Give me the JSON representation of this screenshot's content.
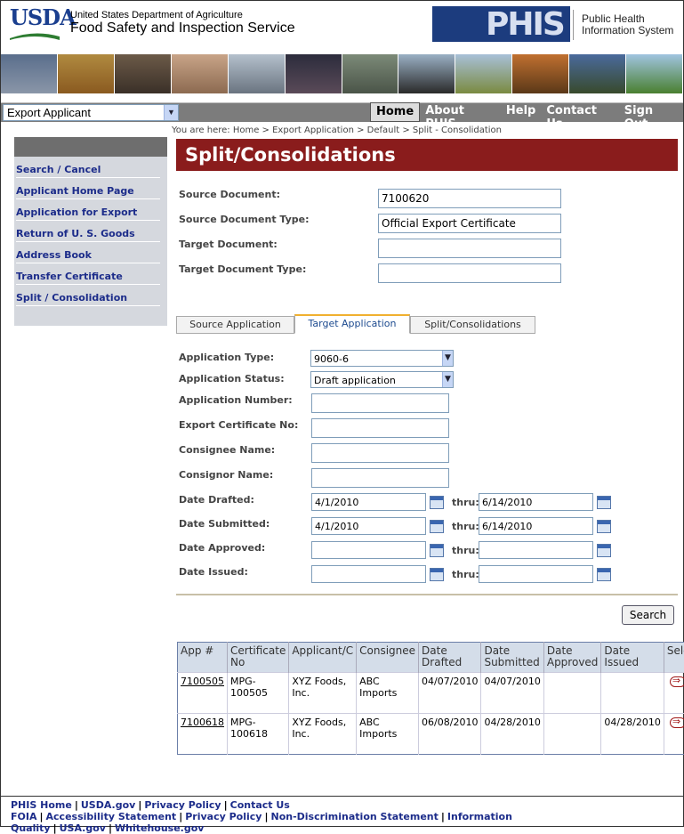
{
  "header": {
    "usda_logo": "USDA",
    "dept_name": "United States Department of Agriculture",
    "agency_name": "Food Safety and Inspection Service",
    "phis_logo": "PHIS",
    "phis_name_line1": "Public Health",
    "phis_name_line2": "Information System"
  },
  "role_select": {
    "value": "Export Applicant"
  },
  "nav": [
    "Home",
    "About PHIS",
    "Help",
    "Contact Us",
    "Sign Out"
  ],
  "breadcrumb": "You are here: Home > Export Application > Default > Split - Consolidation",
  "sidebar": [
    "Search / Cancel",
    "Applicant Home Page",
    "Application for Export",
    "Return of U. S. Goods",
    "Address Book",
    "Transfer Certificate",
    "Split / Consolidation"
  ],
  "page_title": "Split/Consolidations",
  "source_form": {
    "source_document_label": "Source Document:",
    "source_document_value": "7100620",
    "source_document_type_label": "Source Document Type:",
    "source_document_type_value": "Official Export Certificate",
    "target_document_label": "Target Document:",
    "target_document_value": "",
    "target_document_type_label": "Target Document Type:",
    "target_document_type_value": ""
  },
  "tabs": [
    "Source Application",
    "Target Application",
    "Split/Consolidations"
  ],
  "search_form": {
    "application_type_label": "Application Type:",
    "application_type_value": "9060-6",
    "application_status_label": "Application Status:",
    "application_status_value": "Draft application",
    "application_number_label": "Application Number:",
    "export_cert_label": "Export Certificate No:",
    "consignee_label": "Consignee Name:",
    "consignor_label": "Consignor Name:",
    "date_drafted_label": "Date Drafted:",
    "date_drafted_from": "4/1/2010",
    "date_drafted_thru": "6/14/2010",
    "date_submitted_label": "Date Submitted:",
    "date_submitted_from": "4/1/2010",
    "date_submitted_thru": "6/14/2010",
    "date_approved_label": "Date Approved:",
    "date_issued_label": "Date Issued:",
    "thru_label": "thru:",
    "search_button": "Search"
  },
  "results": {
    "headers": [
      "App #",
      "Certificate No",
      "Applicant/C",
      "Consignee",
      "Date Drafted",
      "Date Submitted",
      "Date Approved",
      "Date Issued",
      "Select"
    ],
    "rows": [
      {
        "app": "7100505",
        "cert": "MPG-100505",
        "applicant": "XYZ Foods, Inc.",
        "consignee": "ABC Imports",
        "drafted": "04/07/2010",
        "submitted": "04/07/2010",
        "approved": "",
        "issued": ""
      },
      {
        "app": "7100618",
        "cert": "MPG-100618",
        "applicant": "XYZ Foods, Inc.",
        "consignee": "ABC Imports",
        "drafted": "06/08/2010",
        "submitted": "04/28/2010",
        "approved": "",
        "issued": "04/28/2010"
      }
    ]
  },
  "footer": {
    "line1": [
      "PHIS Home",
      "USDA.gov",
      "Privacy Policy",
      "Contact Us"
    ],
    "line2": [
      "FOIA",
      "Accessibility Statement",
      "Privacy Policy",
      "Non-Discrimination Statement",
      "Information Quality",
      "USA.gov",
      "Whitehouse.gov"
    ]
  }
}
